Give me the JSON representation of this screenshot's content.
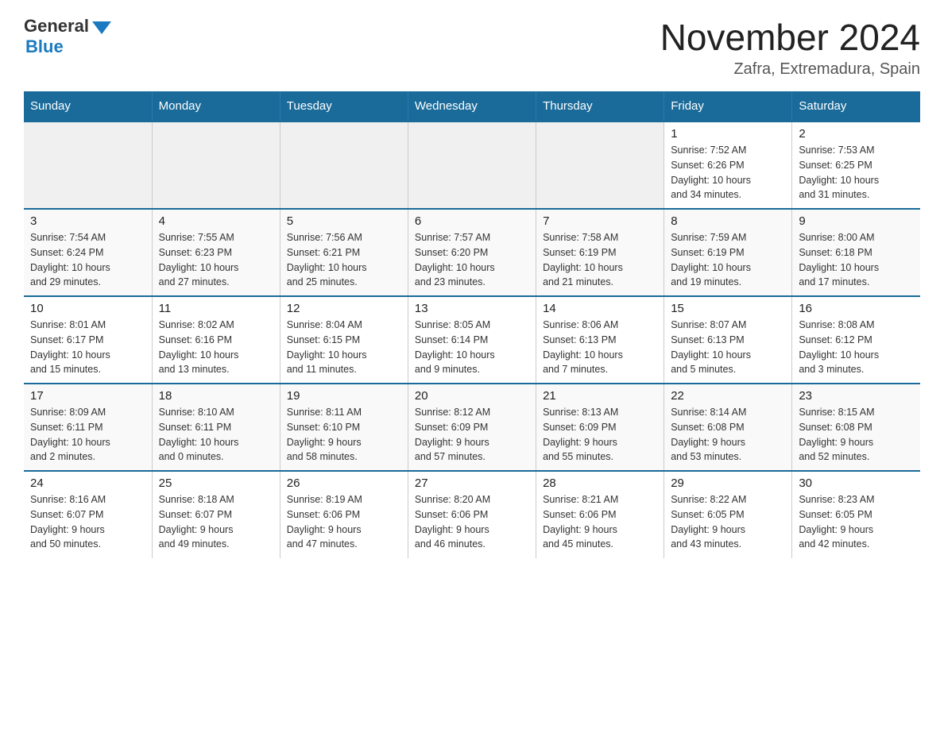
{
  "logo": {
    "general": "General",
    "blue": "Blue"
  },
  "title": "November 2024",
  "location": "Zafra, Extremadura, Spain",
  "days_of_week": [
    "Sunday",
    "Monday",
    "Tuesday",
    "Wednesday",
    "Thursday",
    "Friday",
    "Saturday"
  ],
  "weeks": [
    [
      {
        "day": "",
        "info": ""
      },
      {
        "day": "",
        "info": ""
      },
      {
        "day": "",
        "info": ""
      },
      {
        "day": "",
        "info": ""
      },
      {
        "day": "",
        "info": ""
      },
      {
        "day": "1",
        "info": "Sunrise: 7:52 AM\nSunset: 6:26 PM\nDaylight: 10 hours\nand 34 minutes."
      },
      {
        "day": "2",
        "info": "Sunrise: 7:53 AM\nSunset: 6:25 PM\nDaylight: 10 hours\nand 31 minutes."
      }
    ],
    [
      {
        "day": "3",
        "info": "Sunrise: 7:54 AM\nSunset: 6:24 PM\nDaylight: 10 hours\nand 29 minutes."
      },
      {
        "day": "4",
        "info": "Sunrise: 7:55 AM\nSunset: 6:23 PM\nDaylight: 10 hours\nand 27 minutes."
      },
      {
        "day": "5",
        "info": "Sunrise: 7:56 AM\nSunset: 6:21 PM\nDaylight: 10 hours\nand 25 minutes."
      },
      {
        "day": "6",
        "info": "Sunrise: 7:57 AM\nSunset: 6:20 PM\nDaylight: 10 hours\nand 23 minutes."
      },
      {
        "day": "7",
        "info": "Sunrise: 7:58 AM\nSunset: 6:19 PM\nDaylight: 10 hours\nand 21 minutes."
      },
      {
        "day": "8",
        "info": "Sunrise: 7:59 AM\nSunset: 6:19 PM\nDaylight: 10 hours\nand 19 minutes."
      },
      {
        "day": "9",
        "info": "Sunrise: 8:00 AM\nSunset: 6:18 PM\nDaylight: 10 hours\nand 17 minutes."
      }
    ],
    [
      {
        "day": "10",
        "info": "Sunrise: 8:01 AM\nSunset: 6:17 PM\nDaylight: 10 hours\nand 15 minutes."
      },
      {
        "day": "11",
        "info": "Sunrise: 8:02 AM\nSunset: 6:16 PM\nDaylight: 10 hours\nand 13 minutes."
      },
      {
        "day": "12",
        "info": "Sunrise: 8:04 AM\nSunset: 6:15 PM\nDaylight: 10 hours\nand 11 minutes."
      },
      {
        "day": "13",
        "info": "Sunrise: 8:05 AM\nSunset: 6:14 PM\nDaylight: 10 hours\nand 9 minutes."
      },
      {
        "day": "14",
        "info": "Sunrise: 8:06 AM\nSunset: 6:13 PM\nDaylight: 10 hours\nand 7 minutes."
      },
      {
        "day": "15",
        "info": "Sunrise: 8:07 AM\nSunset: 6:13 PM\nDaylight: 10 hours\nand 5 minutes."
      },
      {
        "day": "16",
        "info": "Sunrise: 8:08 AM\nSunset: 6:12 PM\nDaylight: 10 hours\nand 3 minutes."
      }
    ],
    [
      {
        "day": "17",
        "info": "Sunrise: 8:09 AM\nSunset: 6:11 PM\nDaylight: 10 hours\nand 2 minutes."
      },
      {
        "day": "18",
        "info": "Sunrise: 8:10 AM\nSunset: 6:11 PM\nDaylight: 10 hours\nand 0 minutes."
      },
      {
        "day": "19",
        "info": "Sunrise: 8:11 AM\nSunset: 6:10 PM\nDaylight: 9 hours\nand 58 minutes."
      },
      {
        "day": "20",
        "info": "Sunrise: 8:12 AM\nSunset: 6:09 PM\nDaylight: 9 hours\nand 57 minutes."
      },
      {
        "day": "21",
        "info": "Sunrise: 8:13 AM\nSunset: 6:09 PM\nDaylight: 9 hours\nand 55 minutes."
      },
      {
        "day": "22",
        "info": "Sunrise: 8:14 AM\nSunset: 6:08 PM\nDaylight: 9 hours\nand 53 minutes."
      },
      {
        "day": "23",
        "info": "Sunrise: 8:15 AM\nSunset: 6:08 PM\nDaylight: 9 hours\nand 52 minutes."
      }
    ],
    [
      {
        "day": "24",
        "info": "Sunrise: 8:16 AM\nSunset: 6:07 PM\nDaylight: 9 hours\nand 50 minutes."
      },
      {
        "day": "25",
        "info": "Sunrise: 8:18 AM\nSunset: 6:07 PM\nDaylight: 9 hours\nand 49 minutes."
      },
      {
        "day": "26",
        "info": "Sunrise: 8:19 AM\nSunset: 6:06 PM\nDaylight: 9 hours\nand 47 minutes."
      },
      {
        "day": "27",
        "info": "Sunrise: 8:20 AM\nSunset: 6:06 PM\nDaylight: 9 hours\nand 46 minutes."
      },
      {
        "day": "28",
        "info": "Sunrise: 8:21 AM\nSunset: 6:06 PM\nDaylight: 9 hours\nand 45 minutes."
      },
      {
        "day": "29",
        "info": "Sunrise: 8:22 AM\nSunset: 6:05 PM\nDaylight: 9 hours\nand 43 minutes."
      },
      {
        "day": "30",
        "info": "Sunrise: 8:23 AM\nSunset: 6:05 PM\nDaylight: 9 hours\nand 42 minutes."
      }
    ]
  ]
}
